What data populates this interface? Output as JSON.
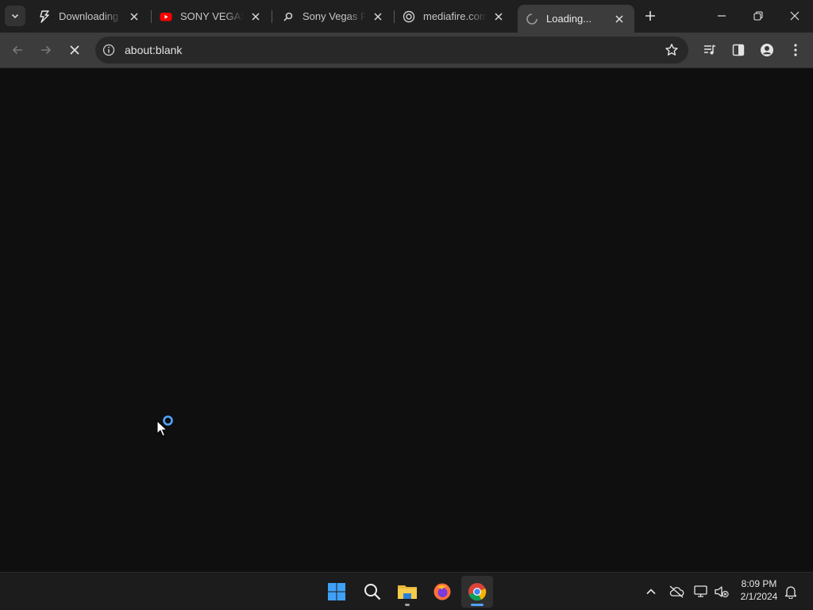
{
  "tabs": [
    {
      "title": "Downloading T",
      "favicon": "bolt-icon",
      "active": false
    },
    {
      "title": "SONY VEGAS PI",
      "favicon": "youtube-icon",
      "active": false
    },
    {
      "title": "Sony Vegas Pro",
      "favicon": "vegas-icon",
      "active": false
    },
    {
      "title": "mediafire.com/",
      "favicon": "mediafire-icon",
      "active": false
    },
    {
      "title": "Loading...",
      "favicon": "spinner-icon",
      "active": true
    }
  ],
  "toolbar": {
    "url": "about:blank"
  },
  "taskbar": {
    "time": "8:09 PM",
    "date": "2/1/2024"
  },
  "colors": {
    "accent": "#4fa3ff",
    "youtube": "#ff0000",
    "page_bg": "#0f0f0f"
  }
}
